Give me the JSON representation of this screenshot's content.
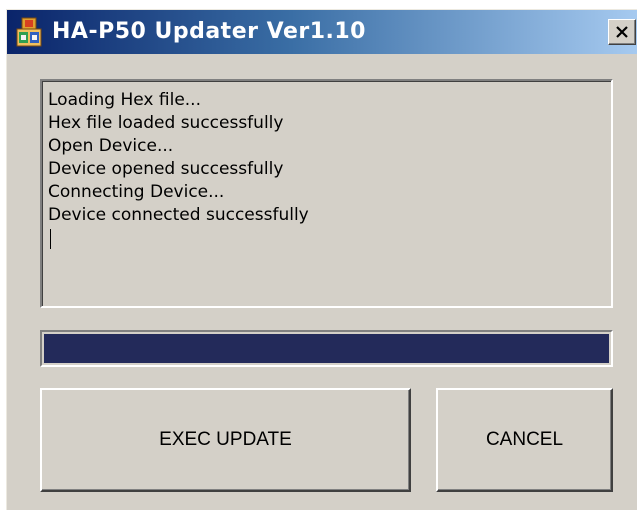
{
  "window": {
    "title": "HA-P50 Updater Ver1.10",
    "app_icon": "package-icon",
    "close_icon": "close-icon"
  },
  "log": {
    "lines": [
      "Loading Hex file...",
      "Hex file loaded successfully",
      "Open Device...",
      "Device opened successfully",
      "Connecting Device...",
      "Device connected successfully"
    ]
  },
  "progress": {
    "percent": 100,
    "fill_color": "#232a5a"
  },
  "buttons": {
    "exec_label": "EXEC UPDATE",
    "cancel_label": "CANCEL"
  },
  "colors": {
    "title_gradient_start": "#0a246a",
    "title_gradient_end": "#a6caf0",
    "window_face": "#d4d0c8"
  }
}
